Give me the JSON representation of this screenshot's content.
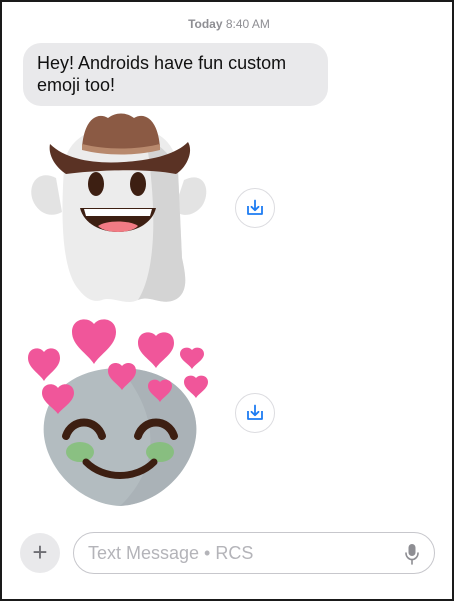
{
  "conversation": {
    "timestamp_day": "Today",
    "timestamp_time": "8:40 AM",
    "messages": [
      {
        "text": "Hey! Androids have fun custom emoji too!"
      }
    ],
    "stickers": [
      {
        "icon": "cowboy-ghost-emoji"
      },
      {
        "icon": "heart-eyes-alien-emoji"
      }
    ]
  },
  "composer": {
    "placeholder": "Text Message • RCS",
    "value": "",
    "plus_label": "+",
    "mic_icon": "microphone-icon"
  },
  "colors": {
    "bubble": "#e9e9eb",
    "accent": "#007aff",
    "heart": "#f0569a"
  }
}
